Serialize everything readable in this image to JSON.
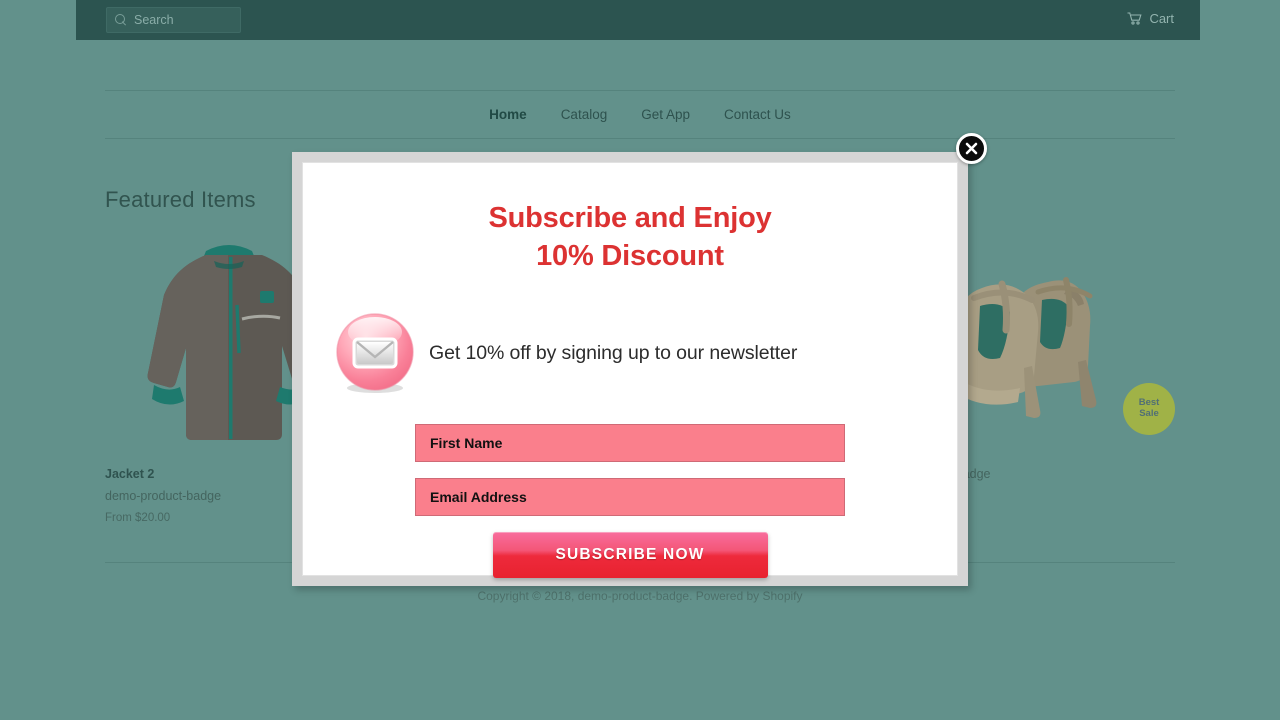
{
  "topbar": {
    "search": {
      "placeholder": "Search",
      "value": "",
      "icon": "search-icon"
    },
    "cart": {
      "label": "Cart",
      "icon": "cart-icon"
    }
  },
  "nav": {
    "items": [
      {
        "label": "Home",
        "active": true
      },
      {
        "label": "Catalog",
        "active": false
      },
      {
        "label": "Get App",
        "active": false
      },
      {
        "label": "Contact Us",
        "active": false
      }
    ]
  },
  "main": {
    "section_title": "Featured Items",
    "products": [
      {
        "name": "Jacket 2",
        "vendor": "demo-product-badge",
        "price": "From $20.00",
        "image": "gray-jacket-photo",
        "badge": null
      },
      {
        "name": "",
        "vendor": "",
        "price": "",
        "image": "product-photo",
        "badge": null
      },
      {
        "name": "",
        "vendor": "",
        "price": "",
        "image": "product-photo",
        "badge": null
      },
      {
        "name": "",
        "vendor": "oduct-badge",
        "price": "",
        "image": "beige-heels-photo",
        "badge": {
          "line1": "Best",
          "line2": "Sale",
          "color": "#a9b73e"
        }
      }
    ]
  },
  "footer": {
    "text": "Copyright © 2018, demo-product-badge. Powered by ",
    "link": "Shopify"
  },
  "modal": {
    "close_icon": "close-circle-icon",
    "headline_line1": "Subscribe and Enjoy",
    "headline_line2": "10% Discount",
    "headline_color": "#dc3232",
    "envelope_icon": "envelope-icon",
    "subtext": "Get 10% off by signing up to our newsletter",
    "fields": [
      {
        "name": "first-name",
        "placeholder": "First Name",
        "value": ""
      },
      {
        "name": "email-address",
        "placeholder": "Email Address",
        "value": ""
      }
    ],
    "submit_label": "SUBSCRIBE NOW",
    "field_color": "#fa7f8c",
    "button_gradient_top": "#f86d9d",
    "button_gradient_bottom": "#e8222f"
  },
  "theme": {
    "body_bg": "#62918b",
    "header_bg": "#2c5450",
    "rule_color": "#55837d"
  }
}
